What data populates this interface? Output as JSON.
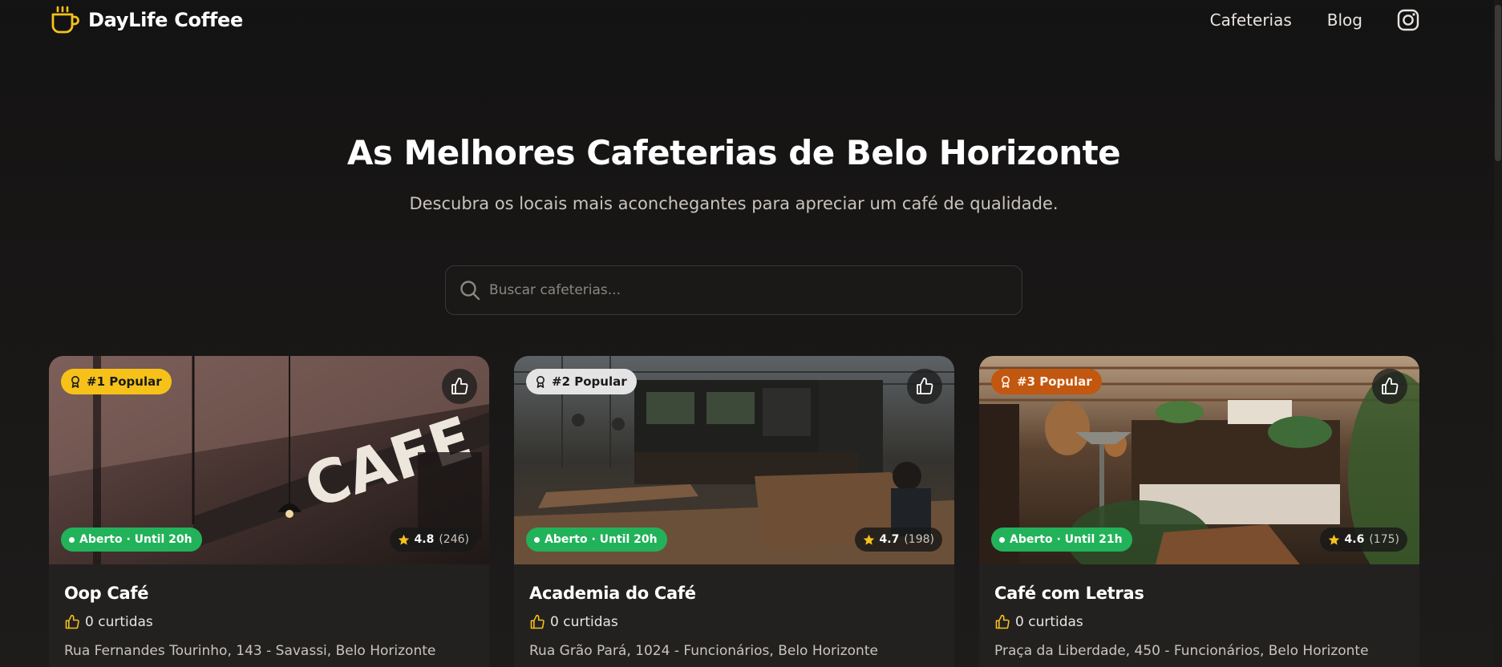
{
  "header": {
    "brand": "DayLife Coffee",
    "nav": [
      "Cafeterias",
      "Blog"
    ],
    "instagram_icon": "instagram-icon"
  },
  "hero": {
    "title": "As Melhores Cafeterias de Belo Horizonte",
    "subtitle": "Descubra os locais mais aconchegantes para apreciar um café de qualidade."
  },
  "search": {
    "placeholder": "Buscar cafeterias..."
  },
  "colors": {
    "accent": "#f6c21a",
    "open": "#22b25a",
    "rank2": "#e4e4e4",
    "rank3": "#c25710"
  },
  "cards": [
    {
      "rank": "#1 Popular",
      "status": "Aberto · Until 20h",
      "rating": "4.8",
      "reviews": "(246)",
      "name": "Oop Café",
      "likes": "0 curtidas",
      "address": "Rua Fernandes Tourinho, 143 - Savassi, Belo Horizonte"
    },
    {
      "rank": "#2 Popular",
      "status": "Aberto · Until 20h",
      "rating": "4.7",
      "reviews": "(198)",
      "name": "Academia do Café",
      "likes": "0 curtidas",
      "address": "Rua Grão Pará, 1024 - Funcionários, Belo Horizonte"
    },
    {
      "rank": "#3 Popular",
      "status": "Aberto · Until 21h",
      "rating": "4.6",
      "reviews": "(175)",
      "name": "Café com Letras",
      "likes": "0 curtidas",
      "address": "Praça da Liberdade, 450 - Funcionários, Belo Horizonte"
    }
  ]
}
